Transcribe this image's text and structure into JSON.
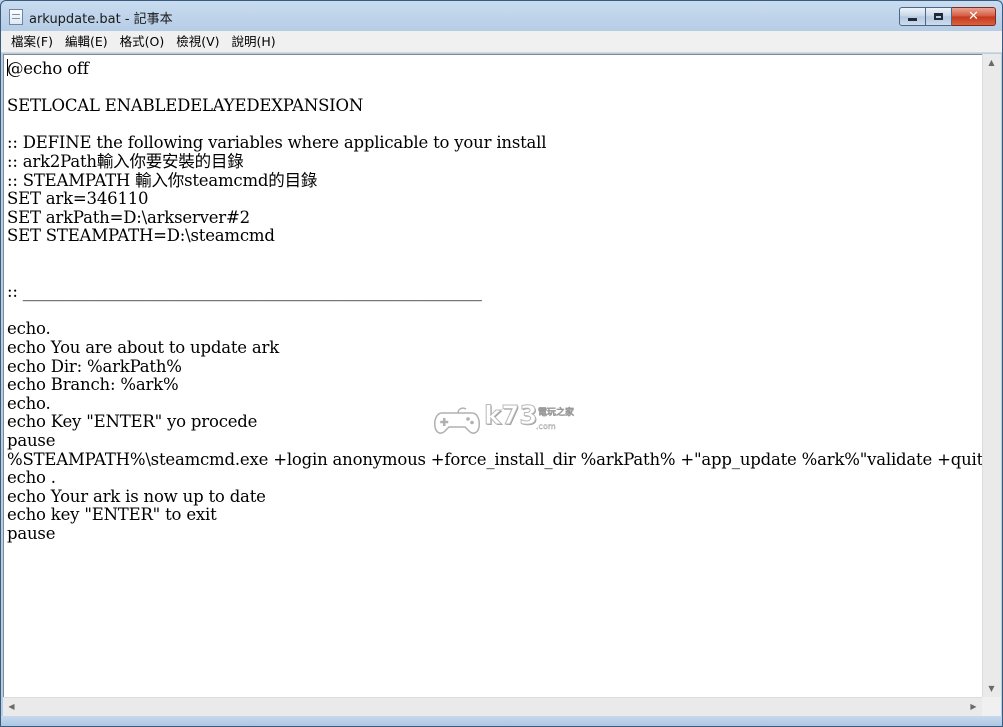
{
  "window": {
    "title": "arkupdate.bat - 記事本"
  },
  "menu": {
    "items": [
      "檔案(F)",
      "編輯(E)",
      "格式(O)",
      "檢視(V)",
      "說明(H)"
    ]
  },
  "editor": {
    "lines": [
      "@echo off",
      "",
      "SETLOCAL ENABLEDELAYEDEXPANSION",
      "",
      ":: DEFINE the following variables where applicable to your install",
      ":: ark2Path輸入你要安裝的目錄",
      ":: STEAMPATH 輸入你steamcmd的目錄",
      "SET ark=346110",
      "SET arkPath=D:\\arkserver#2",
      "SET STEAMPATH=D:\\steamcmd",
      "",
      "",
      ":: _________________________________________________________",
      "",
      "echo.",
      "echo You are about to update ark",
      "echo Dir: %arkPath%",
      "echo Branch: %ark%",
      "echo.",
      "echo Key \"ENTER\" yo procede",
      "pause",
      "%STEAMPATH%\\steamcmd.exe +login anonymous +force_install_dir %arkPath% +\"app_update %ark%\"validate +quit",
      "echo .",
      "echo Your ark is now up to date",
      "echo key \"ENTER\" to exit",
      "pause"
    ]
  },
  "watermark": {
    "brand": "k73",
    "tagline": "電玩之家",
    "domain": ".com"
  },
  "icons": {
    "app": "notepad-icon",
    "minimize": "minimize-icon",
    "maximize": "maximize-icon",
    "close": "close-icon",
    "scroll_up": "chevron-up-icon",
    "scroll_down": "chevron-down-icon",
    "scroll_left": "chevron-left-icon",
    "scroll_right": "chevron-right-icon"
  },
  "colors": {
    "titlebar": "#b6cde6",
    "close_button": "#c4371c",
    "editor_bg": "#ffffff",
    "text": "#000000"
  }
}
